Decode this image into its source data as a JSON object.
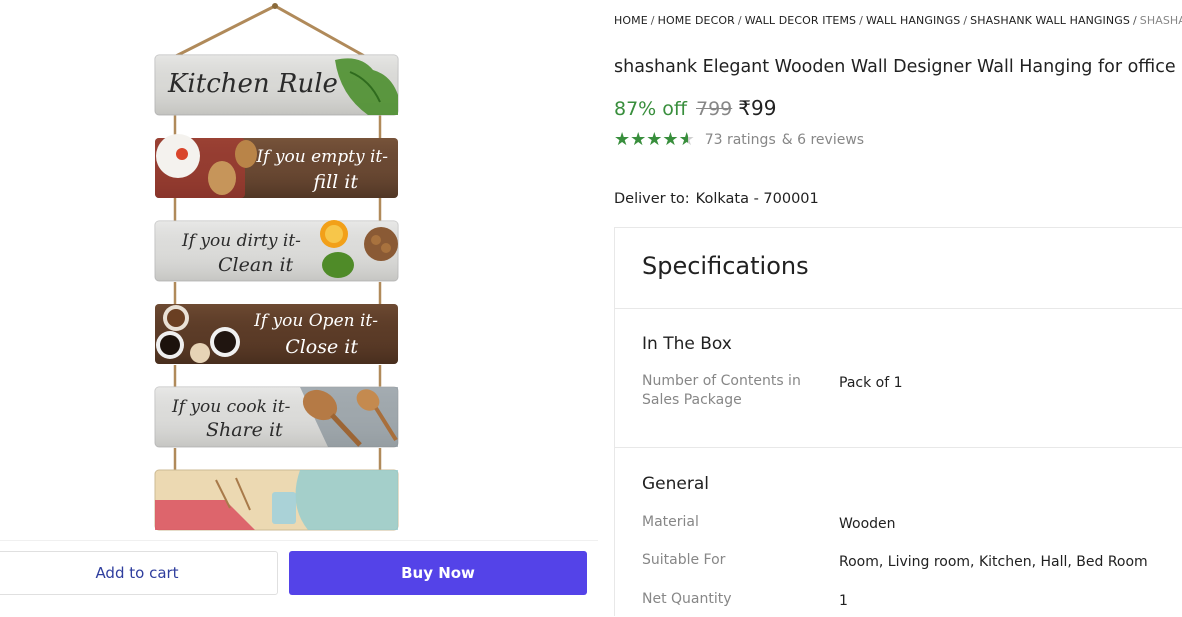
{
  "product_image": {
    "planks": [
      {
        "line1": "Kitchen Rule",
        "line2": ""
      },
      {
        "line1": "If you empty it-",
        "line2": "fill it"
      },
      {
        "line1": "If you dirty it-",
        "line2": "Clean it"
      },
      {
        "line1": "If you Open it-",
        "line2": "Close it"
      },
      {
        "line1": "If you cook it-",
        "line2": "Share it"
      },
      {
        "line1": "",
        "line2": ""
      }
    ]
  },
  "actions": {
    "add_to_cart": "Add to cart",
    "buy_now": "Buy Now"
  },
  "breadcrumb": {
    "items": [
      "HOME",
      "HOME DECOR",
      "WALL DECOR ITEMS",
      "WALL HANGINGS",
      "SHASHANK WALL HANGINGS",
      "SHASHAN"
    ],
    "separator": "/"
  },
  "product": {
    "title": "shashank Elegant Wooden Wall Designer Wall Hanging for office and",
    "discount": "87% off",
    "mrp": "799",
    "price": "₹99",
    "rating_stars": 4.5,
    "ratings": "73 ratings",
    "reviews": "& 6 reviews"
  },
  "delivery": {
    "label": "Deliver to:",
    "location": "Kolkata - 700001"
  },
  "specifications": {
    "heading": "Specifications",
    "groups": [
      {
        "title": "In The Box",
        "rows": [
          {
            "label": "Number of Contents in Sales Package",
            "value": "Pack of 1"
          }
        ]
      },
      {
        "title": "General",
        "rows": [
          {
            "label": "Material",
            "value": "Wooden"
          },
          {
            "label": "Suitable For",
            "value": "Room, Living room, Kitchen, Hall, Bed Room"
          },
          {
            "label": "Net Quantity",
            "value": "1"
          }
        ]
      }
    ]
  },
  "colors": {
    "buy_now": "#5443e8",
    "discount_green": "#388e3c",
    "cart_text": "#2f3e9e"
  }
}
